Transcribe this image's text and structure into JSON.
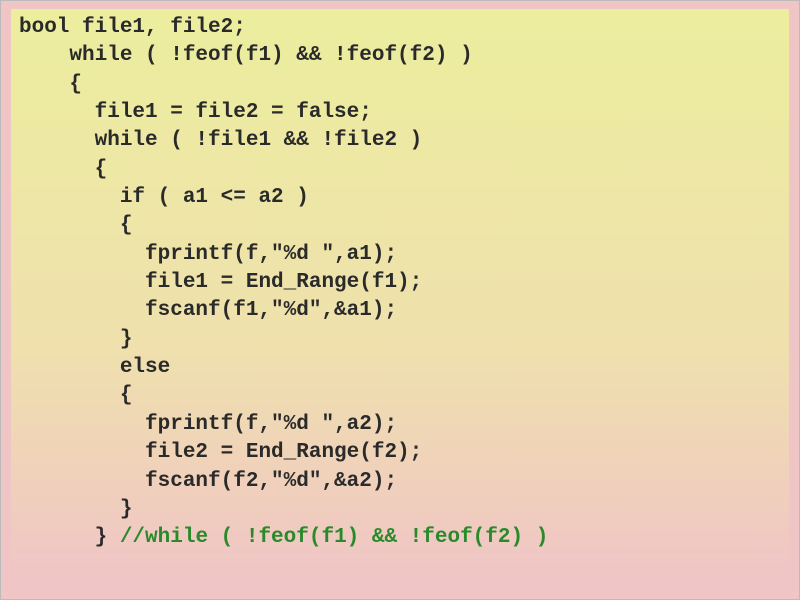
{
  "code": {
    "l1": "bool file1, file2;",
    "l2": "    while ( !feof(f1) && !feof(f2) )",
    "l3": "    {",
    "l4": "      file1 = file2 = false;",
    "l5": "      while ( !file1 && !file2 )",
    "l6": "      {",
    "l7": "        if ( a1 <= a2 )",
    "l8": "        {",
    "l9": "          fprintf(f,\"%d \",a1);",
    "l10": "          file1 = End_Range(f1);",
    "l11": "          fscanf(f1,\"%d\",&a1);",
    "l12": "        }",
    "l13": "        else",
    "l14": "        {",
    "l15": "          fprintf(f,\"%d \",a2);",
    "l16": "          file2 = End_Range(f2);",
    "l17": "          fscanf(f2,\"%d\",&a2);",
    "l18": "        }",
    "l19a": "      } ",
    "l19b": "//while ( !feof(f1) && !feof(f2) )"
  }
}
